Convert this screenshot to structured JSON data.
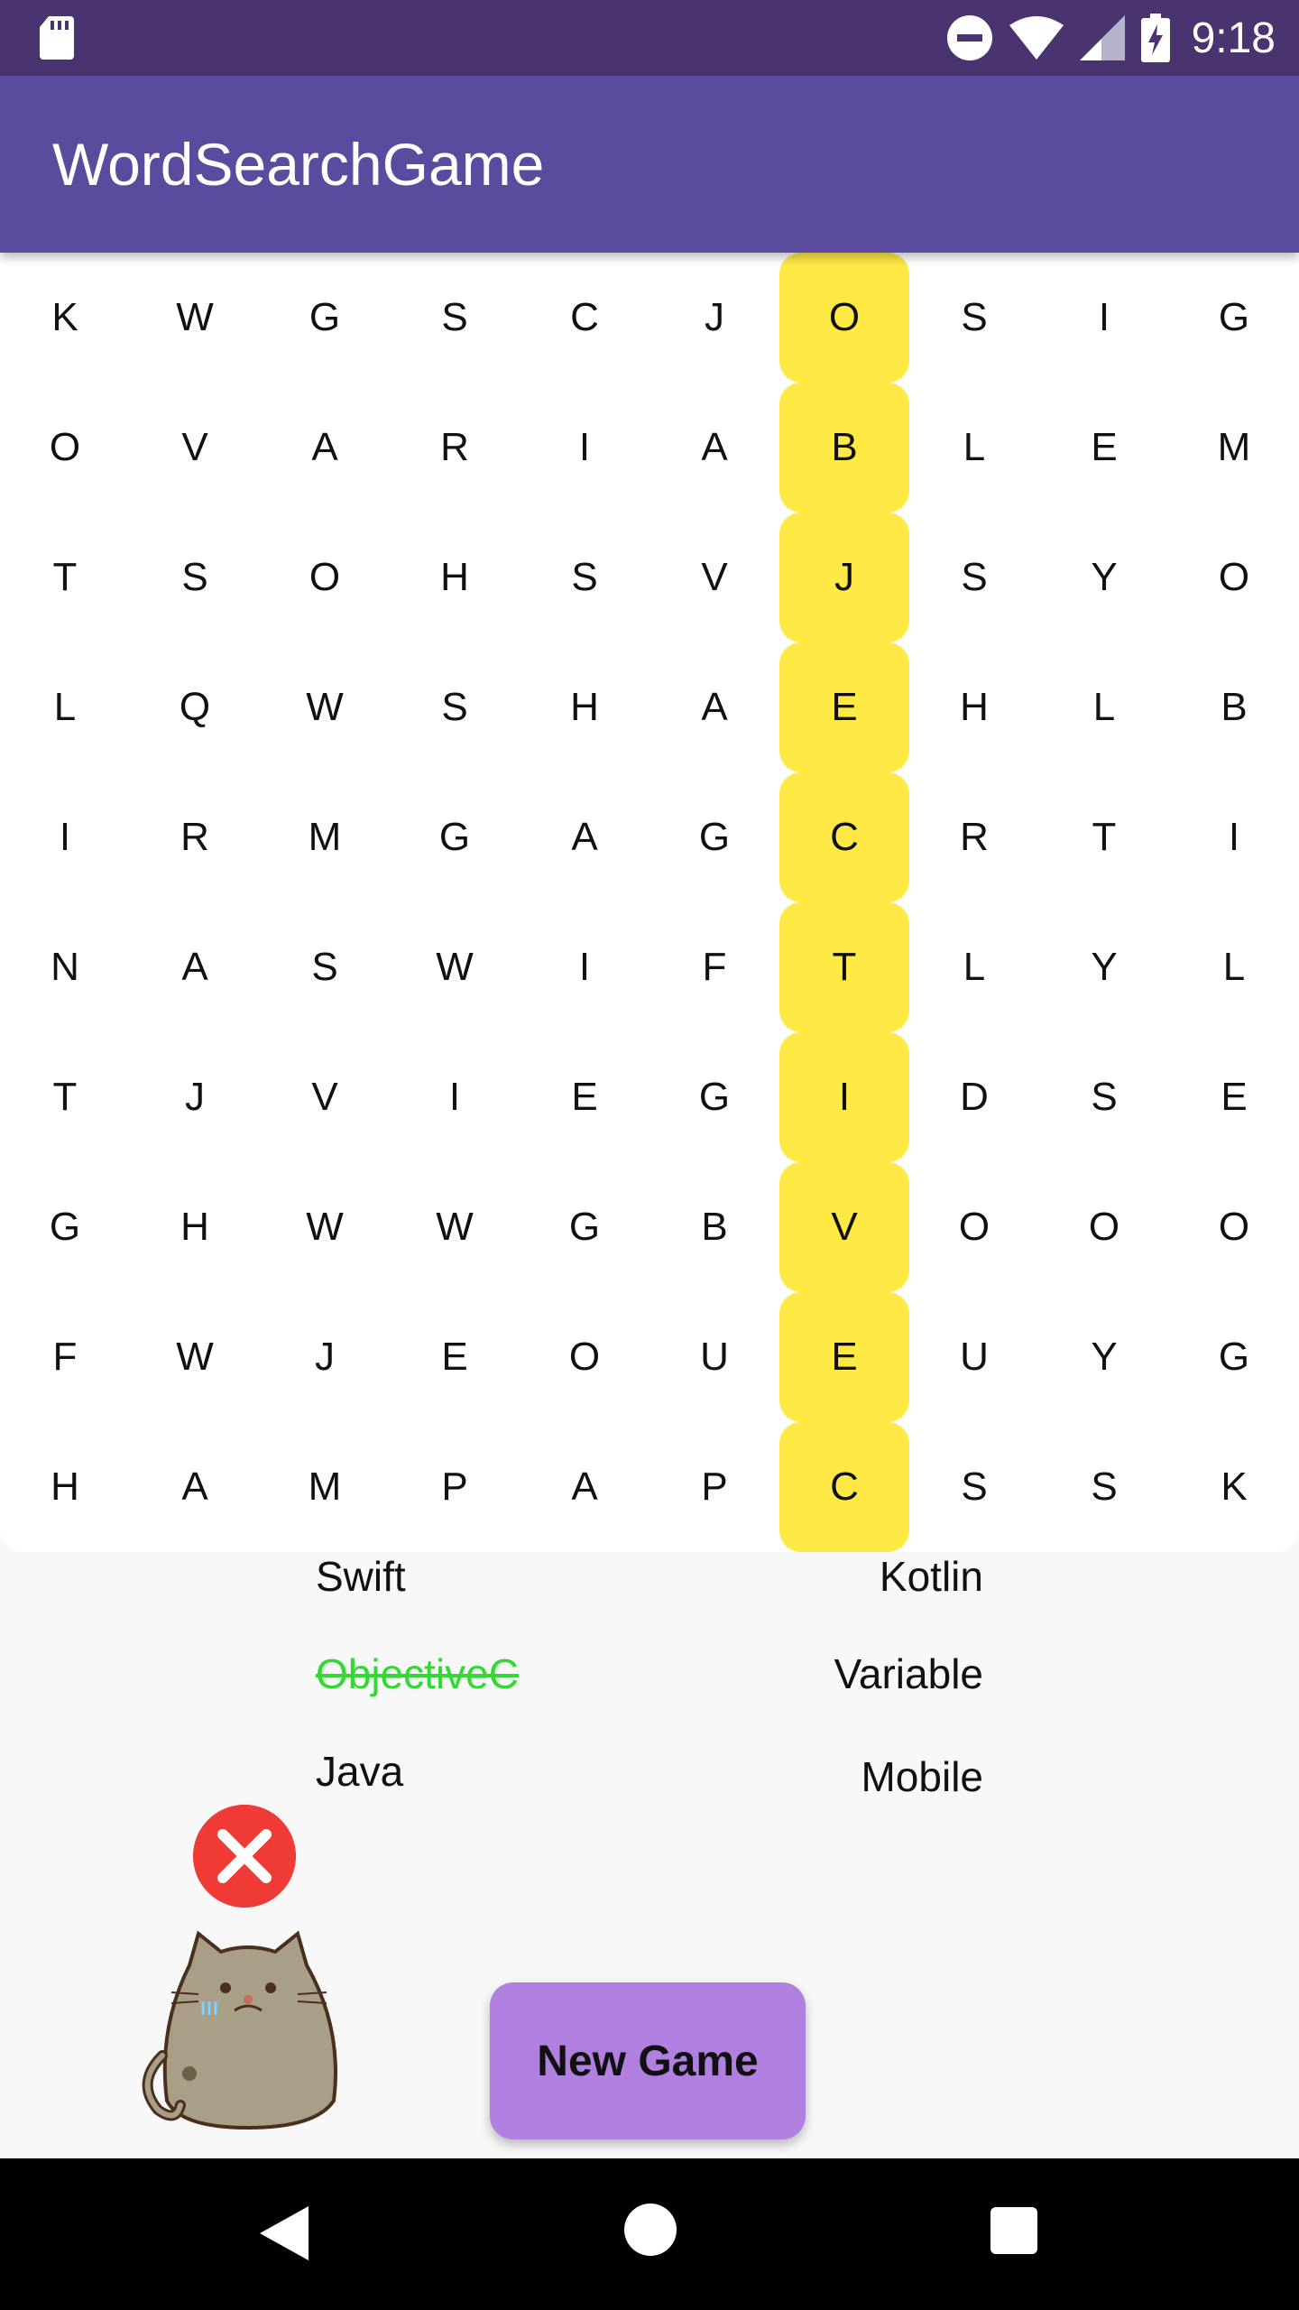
{
  "status_bar": {
    "time": "9:18",
    "icons": [
      "sd-card-icon",
      "do-not-disturb-icon",
      "wifi-icon",
      "signal-icon",
      "battery-charging-icon"
    ]
  },
  "app_bar": {
    "title": "WordSearchGame"
  },
  "grid": {
    "rows": [
      [
        "K",
        "W",
        "G",
        "S",
        "C",
        "J",
        "O",
        "S",
        "I",
        "G"
      ],
      [
        "O",
        "V",
        "A",
        "R",
        "I",
        "A",
        "B",
        "L",
        "E",
        "M"
      ],
      [
        "T",
        "S",
        "O",
        "H",
        "S",
        "V",
        "J",
        "S",
        "Y",
        "O"
      ],
      [
        "L",
        "Q",
        "W",
        "S",
        "H",
        "A",
        "E",
        "H",
        "L",
        "B"
      ],
      [
        "I",
        "R",
        "M",
        "G",
        "A",
        "G",
        "C",
        "R",
        "T",
        "I"
      ],
      [
        "N",
        "A",
        "S",
        "W",
        "I",
        "F",
        "T",
        "L",
        "Y",
        "L"
      ],
      [
        "T",
        "J",
        "V",
        "I",
        "E",
        "G",
        "I",
        "D",
        "S",
        "E"
      ],
      [
        "G",
        "H",
        "W",
        "W",
        "G",
        "B",
        "V",
        "O",
        "O",
        "O"
      ],
      [
        "F",
        "W",
        "J",
        "E",
        "O",
        "U",
        "E",
        "U",
        "Y",
        "G"
      ],
      [
        "H",
        "A",
        "M",
        "P",
        "A",
        "P",
        "C",
        "S",
        "S",
        "K"
      ]
    ],
    "highlighted_column": 6,
    "highlight_color": "#ffe944"
  },
  "words": {
    "left": [
      "Swift",
      "ObjectiveC",
      "Java"
    ],
    "right": [
      "Kotlin",
      "Variable",
      "Mobile"
    ],
    "found": [
      "ObjectiveC"
    ],
    "found_color": "#33d933"
  },
  "feedback": {
    "icon": "wrong-icon",
    "color": "#ef3a36"
  },
  "actions": {
    "new_game_label": "New Game"
  },
  "nav_bar": {
    "icons": [
      "back-icon",
      "home-icon",
      "recents-icon"
    ]
  },
  "colors": {
    "status_bar": "#4a3470",
    "app_bar": "#5b4b9f",
    "button": "#b07fe0"
  }
}
